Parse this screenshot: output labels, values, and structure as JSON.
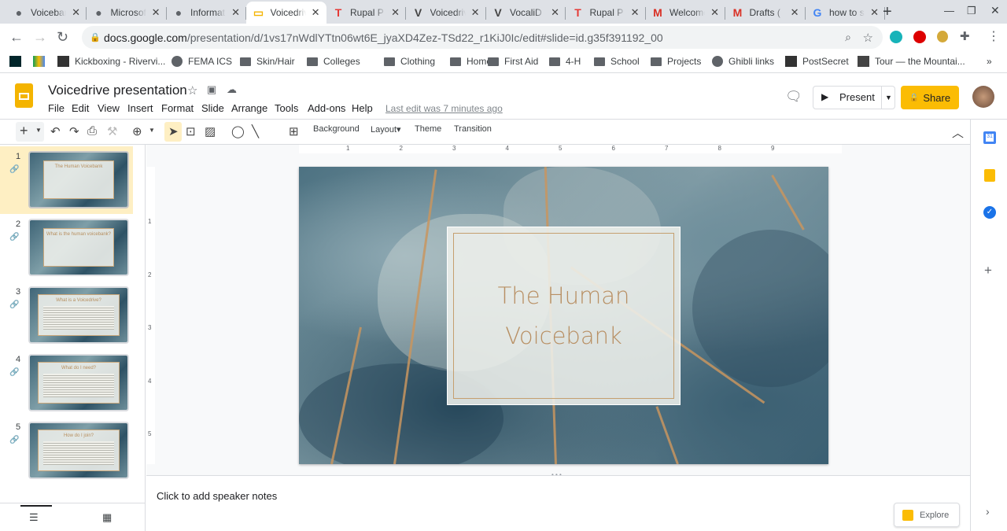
{
  "browser": {
    "tabs": [
      {
        "title": "Voicebank",
        "icon": "globe-icon"
      },
      {
        "title": "Microsoft",
        "icon": "globe-icon"
      },
      {
        "title": "Information",
        "icon": "globe-icon"
      },
      {
        "title": "Voicedrive",
        "icon": "slides-icon",
        "active": true
      },
      {
        "title": "Rupal P",
        "icon": "t-icon"
      },
      {
        "title": "Voicedrive",
        "icon": "v-icon"
      },
      {
        "title": "VocaliD",
        "icon": "v-icon"
      },
      {
        "title": "Rupal P",
        "icon": "t-icon"
      },
      {
        "title": "Welcome",
        "icon": "gmail-icon"
      },
      {
        "title": "Drafts (",
        "icon": "gmail-icon"
      },
      {
        "title": "how to s",
        "icon": "google-icon"
      }
    ],
    "url_domain": "docs.google.com",
    "url_path": "/presentation/d/1vs17nWdlYTtn06wt6E_jyaXD4Zez-TSd22_r1KiJ0Ic/edit#slide=id.g35f391192_00",
    "bookmarks": [
      {
        "label": "",
        "icon": "edx-icon"
      },
      {
        "label": "",
        "icon": "drive-icon"
      },
      {
        "label": "Kickboxing - Rivervi...",
        "icon": "site-icon"
      },
      {
        "label": "FEMA ICS",
        "icon": "globe-icon"
      },
      {
        "label": "Skin/Hair",
        "icon": "folder-icon"
      },
      {
        "label": "Colleges",
        "icon": "folder-icon"
      },
      {
        "label": "Clothing",
        "icon": "folder-icon"
      },
      {
        "label": "Home",
        "icon": "folder-icon"
      },
      {
        "label": "First Aid",
        "icon": "folder-icon"
      },
      {
        "label": "4-H",
        "icon": "folder-icon"
      },
      {
        "label": "School",
        "icon": "folder-icon"
      },
      {
        "label": "Projects",
        "icon": "folder-icon"
      },
      {
        "label": "Ghibli links",
        "icon": "globe-icon"
      },
      {
        "label": "PostSecret",
        "icon": "site-icon"
      },
      {
        "label": "Tour — the Mountai...",
        "icon": "cube-icon"
      }
    ],
    "more_bookmarks": "»"
  },
  "doc": {
    "title": "Voicedrive presentation",
    "menus": [
      "File",
      "Edit",
      "View",
      "Insert",
      "Format",
      "Slide",
      "Arrange",
      "Tools",
      "Add-ons",
      "Help"
    ],
    "last_edit": "Last edit was 7 minutes ago",
    "present": "Present",
    "share": "Share"
  },
  "toolbar": {
    "background": "Background",
    "layout": "Layout",
    "theme": "Theme",
    "transition": "Transition"
  },
  "ruler": [
    "1",
    "2",
    "3",
    "4",
    "5",
    "6",
    "7",
    "8",
    "9"
  ],
  "vruler": [
    "1",
    "2",
    "3",
    "4",
    "5"
  ],
  "slides": [
    {
      "num": "1",
      "title": "The Human Voicebank"
    },
    {
      "num": "2",
      "title": "What is the human voicebank?"
    },
    {
      "num": "3",
      "title": "What is a Voicedrive?"
    },
    {
      "num": "4",
      "title": "What do I need?"
    },
    {
      "num": "5",
      "title": "How do I join?"
    }
  ],
  "slide": {
    "title_line1": "The Human",
    "title_line2": "Voicebank"
  },
  "notes": {
    "placeholder": "Click to add speaker notes"
  },
  "explore": "Explore",
  "colors": {
    "accent": "#fbbc04",
    "share": "#fbbc04"
  }
}
